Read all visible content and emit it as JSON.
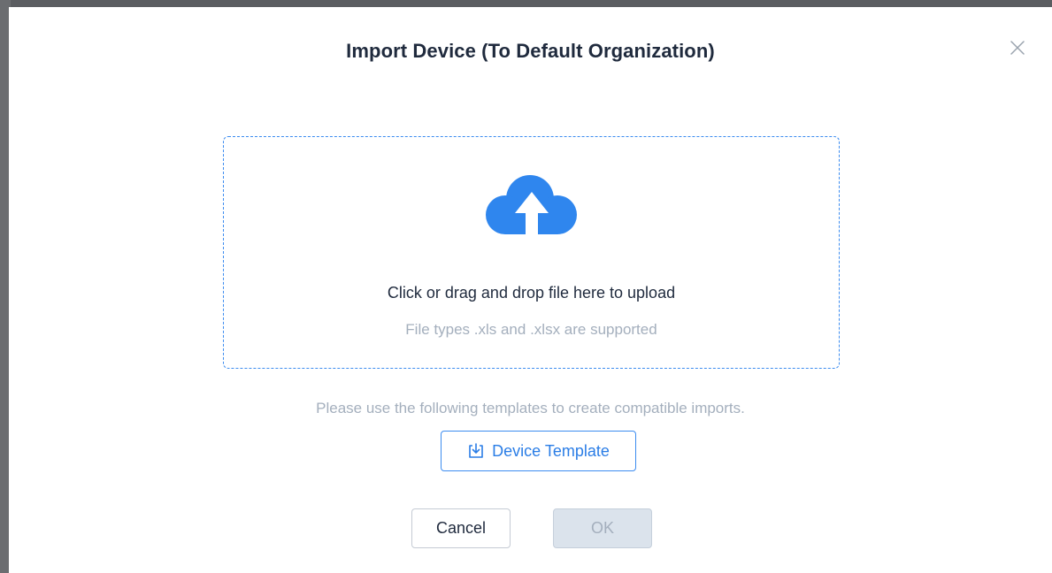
{
  "modal": {
    "title": "Import Device (To Default Organization)"
  },
  "dropzone": {
    "primary_text": "Click or drag and drop file here to upload",
    "secondary_text": "File types .xls and .xlsx are supported",
    "icon": "cloud-upload-icon"
  },
  "templates": {
    "hint": "Please use the following templates to create compatible imports.",
    "device_template_label": "Device Template",
    "icon": "download-icon"
  },
  "footer": {
    "cancel_label": "Cancel",
    "ok_label": "OK"
  },
  "colors": {
    "accent": "#3c8cf0",
    "title_text": "#1f2a3d",
    "muted_text": "#a4afbd",
    "disabled_button_bg": "#dbe3ec"
  }
}
